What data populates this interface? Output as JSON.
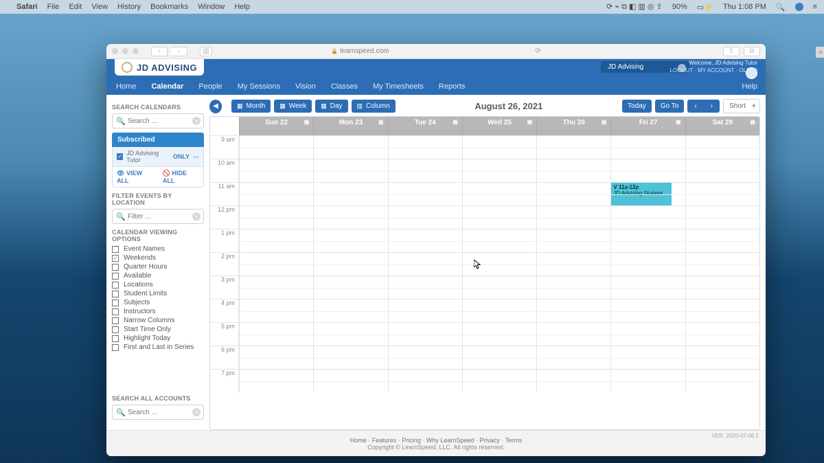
{
  "menubar": {
    "apple": "",
    "app": "Safari",
    "items": [
      "File",
      "Edit",
      "View",
      "History",
      "Bookmarks",
      "Window",
      "Help"
    ],
    "battery": "90%",
    "clock": "Thu 1:08 PM"
  },
  "titlebar": {
    "url": "learnspeed.com"
  },
  "header": {
    "logo": "JD ADVISING",
    "account_combo": "JD Advising",
    "welcome": "Welcome, JD Advising Tutor",
    "links": [
      "LOGOUT",
      "MY ACCOUNT",
      "OLD UI"
    ],
    "nav": [
      "Home",
      "Calendar",
      "People",
      "My Sessions",
      "Vision",
      "Classes",
      "My Timesheets",
      "Reports"
    ],
    "nav_active": "Calendar",
    "help": "Help"
  },
  "sidebar": {
    "search_label": "SEARCH CALENDARS",
    "search_ph": "Search …",
    "subscribed": "Subscribed",
    "sub_item": "JD Advising Tutor",
    "only": "ONLY",
    "view_all": "VIEW ALL",
    "hide_all": "HIDE ALL",
    "filter_label": "FILTER EVENTS BY LOCATION",
    "filter_ph": "Filter …",
    "opts_label": "CALENDAR VIEWING OPTIONS",
    "options": [
      {
        "label": "Event Names",
        "checked": false
      },
      {
        "label": "Weekends",
        "checked": true
      },
      {
        "label": "Quarter Hours",
        "checked": false
      },
      {
        "label": "Available",
        "checked": false
      },
      {
        "label": "Locations",
        "checked": false
      },
      {
        "label": "Student Limits",
        "checked": false
      },
      {
        "label": "Subjects",
        "checked": false
      },
      {
        "label": "Instructors",
        "checked": false
      },
      {
        "label": "Narrow Columns",
        "checked": false
      },
      {
        "label": "Start Time Only",
        "checked": false
      },
      {
        "label": "Highlight Today",
        "checked": false
      },
      {
        "label": "First and Last in Series",
        "checked": false
      }
    ],
    "search_all_label": "SEARCH ALL ACCOUNTS",
    "search_all_ph": "Search …"
  },
  "toolbar": {
    "views": [
      "Month",
      "Week",
      "Day",
      "Column"
    ],
    "date": "August 26, 2021",
    "today": "Today",
    "goto": "Go To",
    "density": "Short"
  },
  "grid": {
    "days": [
      "Sun 22",
      "Mon 23",
      "Tue 24",
      "Wed 25",
      "Thu 26",
      "Fri 27",
      "Sat 28"
    ],
    "hours": [
      "9 am",
      "10 am",
      "11 am",
      "12 pm",
      "1 pm",
      "2 pm",
      "3 pm",
      "4 pm",
      "5 pm",
      "6 pm",
      "7 pm"
    ],
    "event": {
      "day": 5,
      "hour": 2,
      "time": "V 11a-12p",
      "title": "JD Advising Student"
    }
  },
  "footer": {
    "links": [
      "Home",
      "Features",
      "Pricing",
      "Why LearnSpeed",
      "Privacy",
      "Terms"
    ],
    "copyright": "Copyright © LearnSpeed, LLC. All rights reserved.",
    "ver": "VER: 2020-07-06.1"
  }
}
